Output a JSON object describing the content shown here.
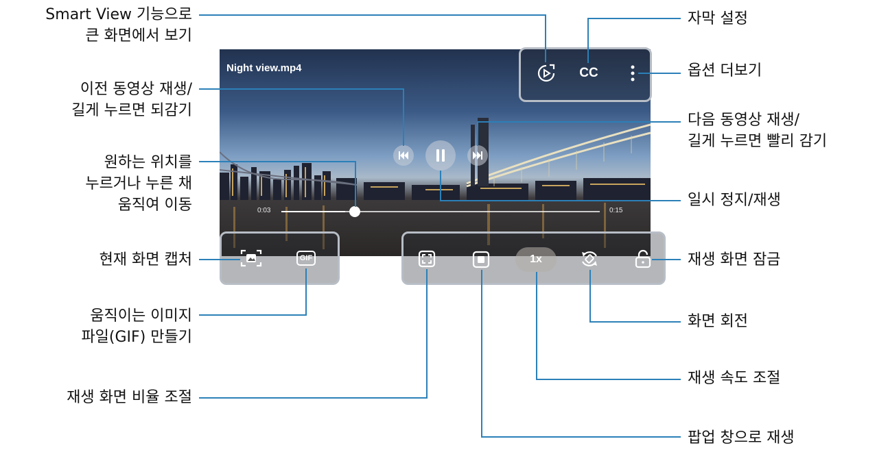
{
  "player": {
    "filename": "Night view.mp4",
    "time_current": "0:03",
    "time_total": "0:15",
    "progress": 0.2,
    "speed": "1x",
    "cc_label": "CC",
    "gif_label": "GIF"
  },
  "callouts": {
    "smart_view": [
      "Smart View 기능으로",
      "큰 화면에서 보기"
    ],
    "prev": [
      "이전 동영상 재생/",
      "길게 누르면 되감기"
    ],
    "seek": [
      "원하는 위치를",
      "누르거나 누른 채",
      "움직여 이동"
    ],
    "capture": "현재 화면 캡처",
    "gif": [
      "움직이는 이미지",
      "파일(GIF) 만들기"
    ],
    "ratio": "재생 화면 비율 조절",
    "subtitle": "자막 설정",
    "more": "옵션 더보기",
    "next": [
      "다음 동영상 재생/",
      "길게 누르면 빨리 감기"
    ],
    "pause": "일시 정지/재생",
    "lock": "재생 화면 잠금",
    "rotate": "화면 회전",
    "speed": "재생 속도 조절",
    "popup": "팝업 창으로 재생"
  },
  "colors": {
    "callout_line": "#2b80b8",
    "panel_border": "#b8bec6"
  }
}
